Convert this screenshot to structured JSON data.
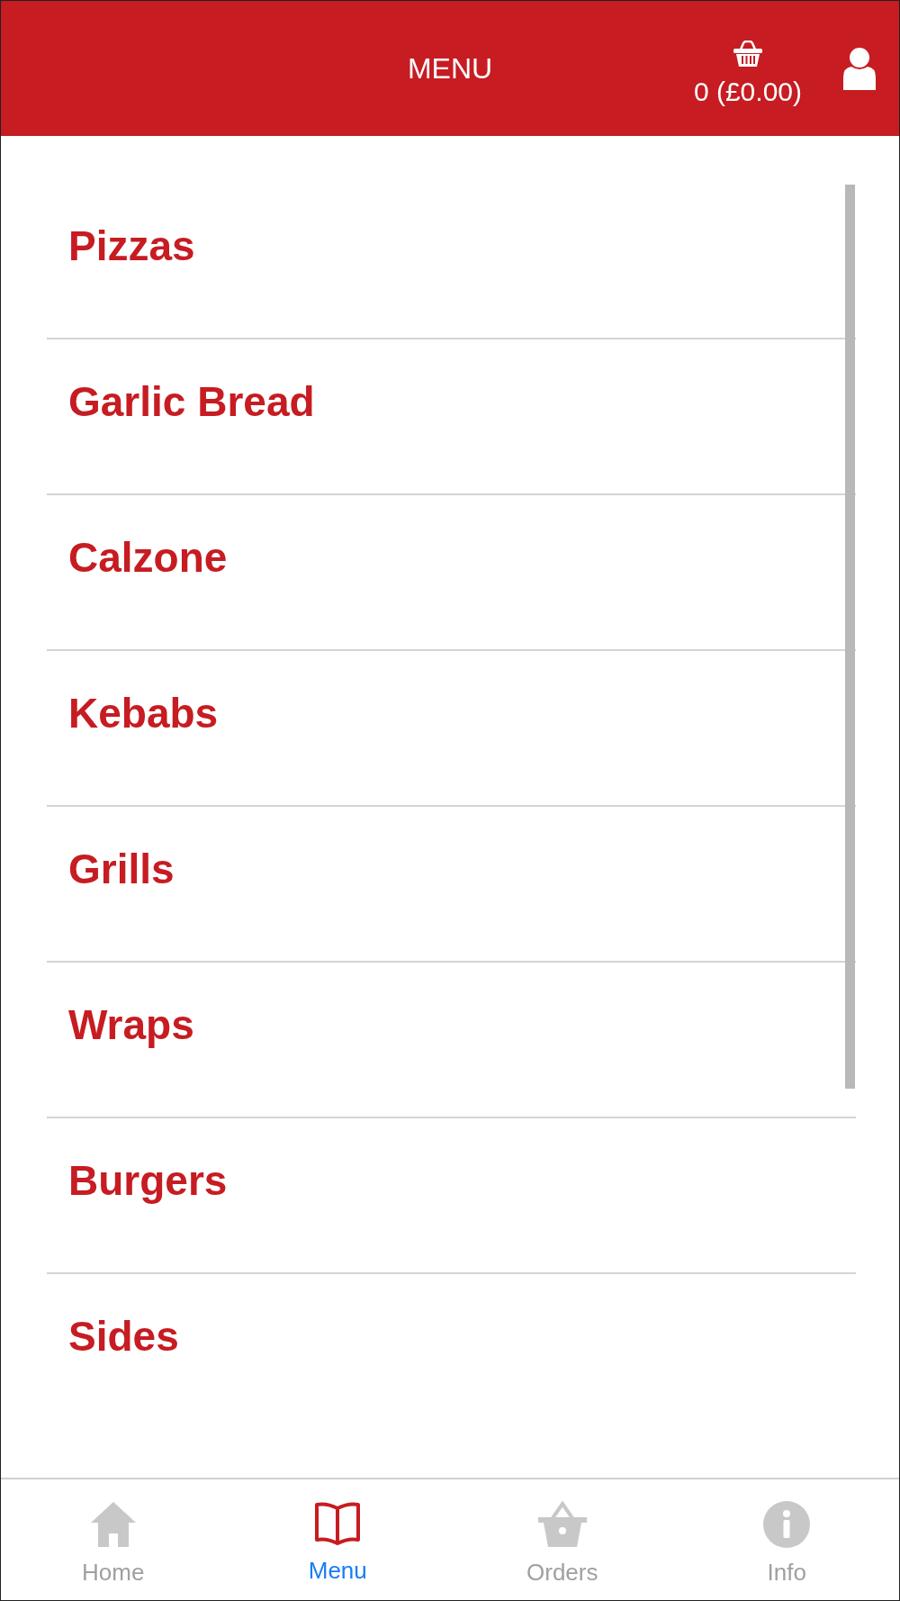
{
  "header": {
    "title": "MENU",
    "cart_summary": "0 (£0.00)"
  },
  "categories": [
    "Pizzas",
    "Garlic Bread",
    "Calzone",
    "Kebabs",
    "Grills",
    "Wraps",
    "Burgers",
    "Sides"
  ],
  "bottom_nav": [
    {
      "kind": "home",
      "label": "Home",
      "selected": false
    },
    {
      "kind": "menu",
      "label": "Menu",
      "selected": true
    },
    {
      "kind": "orders",
      "label": "Orders",
      "selected": false
    },
    {
      "kind": "info",
      "label": "Info",
      "selected": false
    }
  ]
}
